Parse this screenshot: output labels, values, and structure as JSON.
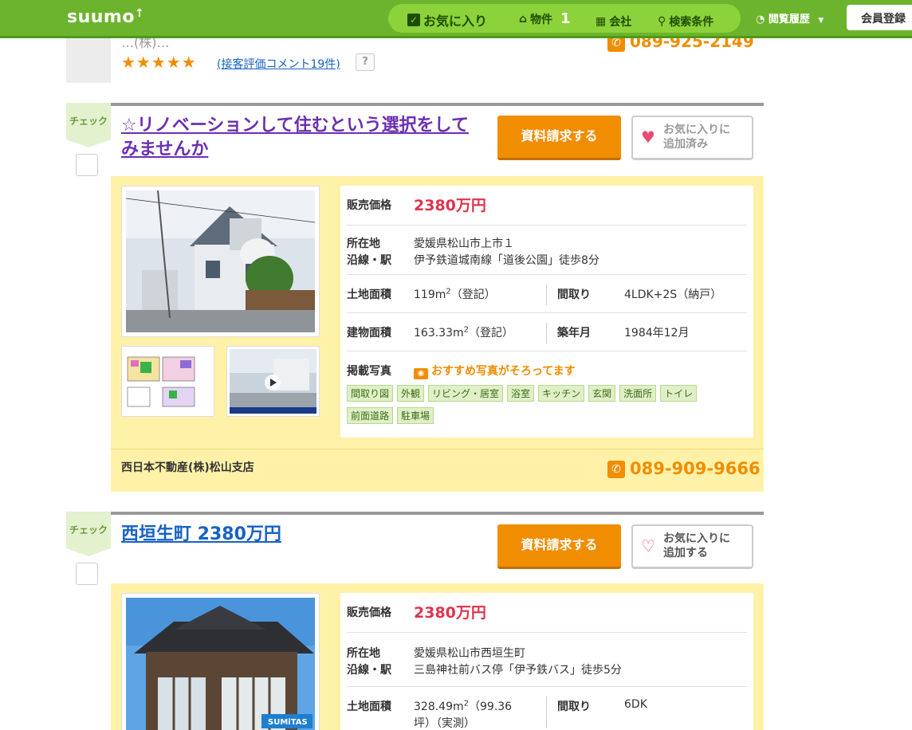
{
  "header": {
    "logo": "suumo",
    "nav": {
      "favorites": "お気に入り",
      "properties": "物件",
      "properties_count": "1",
      "companies": "会社",
      "search_conditions": "検索条件"
    },
    "history": "閲覧履歴",
    "register": "会員登録"
  },
  "previous": {
    "agency_partial": "(株)",
    "stars": "★★★★★",
    "rating_link": "(接客評価コメント19件)",
    "help": "?",
    "phone": "089-925-2149"
  },
  "listings": [
    {
      "check": "チェック",
      "title": "☆リノベーションして住むという選択をしてみませんか",
      "request": "資料請求する",
      "fav": [
        "お気に入りに",
        "追加済み"
      ],
      "labels": {
        "price": "販売価格",
        "location": "所在地",
        "line": "沿線・駅",
        "land": "土地面積",
        "layout": "間取り",
        "building": "建物面積",
        "built": "築年月",
        "photos": "掲載写真"
      },
      "price": "2380万円",
      "location": "愛媛県松山市上市１",
      "line": "伊予鉄道城南線「道後公園」徒歩8分",
      "land_area": [
        "119m",
        "2",
        "（登記）"
      ],
      "layout": "4LDK+2S（納戸）",
      "building_area": [
        "163.33m",
        "2",
        "（登記）"
      ],
      "built": "1984年12月",
      "photo_note": "おすすめ写真がそろってます",
      "tags": [
        "間取り図",
        "外観",
        "リビング・居室",
        "浴室",
        "キッチン",
        "玄関",
        "洗面所",
        "トイレ",
        "前面道路",
        "駐車場"
      ],
      "agency": "西日本不動産(株)松山支店",
      "phone": "089-909-9666"
    },
    {
      "check": "チェック",
      "title": "西垣生町 2380万円",
      "request": "資料請求する",
      "fav": [
        "お気に入りに",
        "追加する"
      ],
      "labels": {
        "price": "販売価格",
        "location": "所在地",
        "line": "沿線・駅",
        "land": "土地面積",
        "layout": "間取り"
      },
      "price": "2380万円",
      "location": "愛媛県松山市西垣生町",
      "line": "三島神社前バス停「伊予鉄バス」徒歩5分",
      "land_area_line1": [
        "328.49m",
        "2",
        "（99.36"
      ],
      "land_area_line2": "坪）（実測）",
      "layout": "6DK",
      "photo_badge": "SUMiTAS"
    }
  ]
}
